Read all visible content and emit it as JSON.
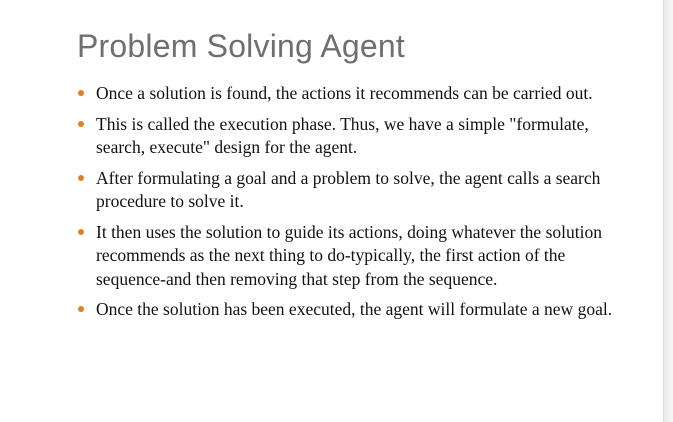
{
  "slide": {
    "title": "Problem Solving Agent",
    "accent_color": "#d9822b",
    "title_color": "#6f6f6f",
    "bullet_icon": "orange-dot-bullet",
    "bullets": [
      "Once a solution is found, the actions it recommends can be carried out.",
      "This is called the execution phase. Thus, we have a simple \"formulate, search, execute\" design for the agent.",
      "After formulating a goal and a problem to solve, the agent calls a search procedure to solve it.",
      "It then uses the solution to guide its actions, doing whatever the solution recommends as the next thing to do-typically, the first action of the sequence-and then removing that step from the sequence.",
      "Once the solution has been executed, the agent will formulate a new goal."
    ]
  }
}
